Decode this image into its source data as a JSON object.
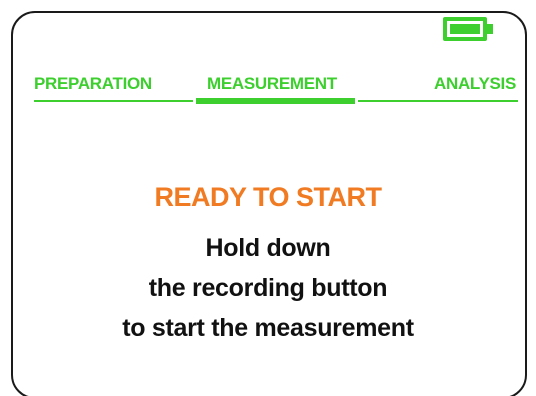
{
  "battery": {
    "icon": "battery-full-icon",
    "level": 1.0,
    "color": "#3ccf2e"
  },
  "steps": [
    {
      "label": "PREPARATION",
      "active": false
    },
    {
      "label": "MEASUREMENT",
      "active": true
    },
    {
      "label": "ANALYSIS",
      "active": false
    }
  ],
  "status": {
    "title": "READY TO START",
    "instructions": [
      "Hold down",
      "the recording button",
      "to start the measurement"
    ]
  },
  "colors": {
    "accent_green": "#3ccf2e",
    "status_orange": "#f07b22",
    "text": "#111111",
    "frame": "#1a1a1a"
  }
}
